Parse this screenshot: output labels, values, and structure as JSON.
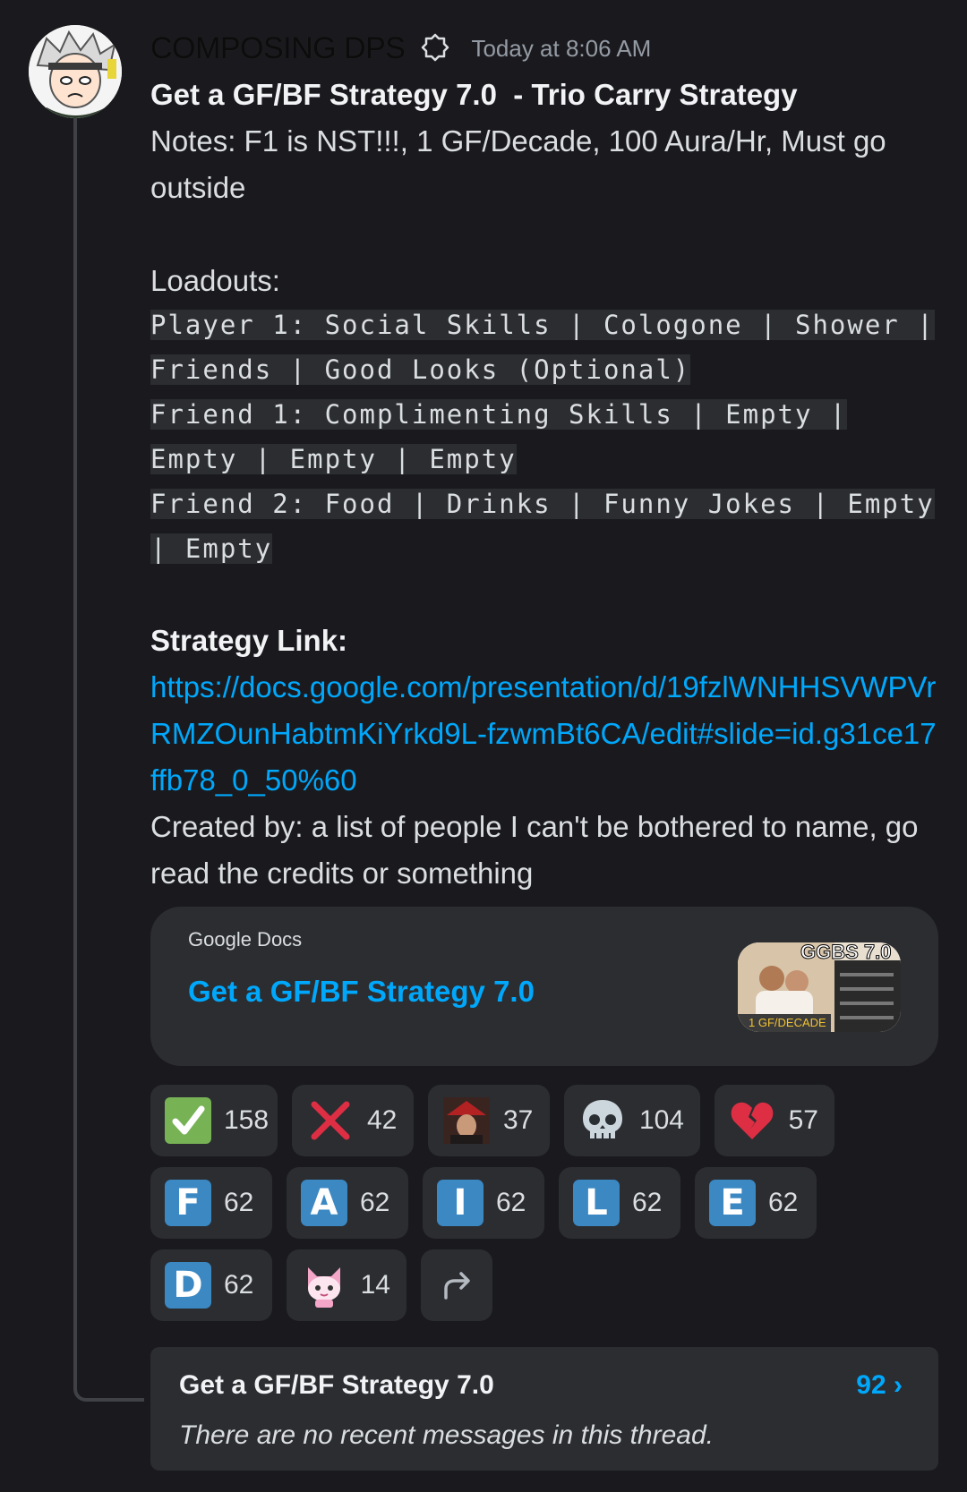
{
  "message": {
    "username": "COMPOSING DPS",
    "timestamp": "Today at 8:06 AM",
    "title": "Get a GF/BF Strategy 7.0  - Trio Carry Strategy",
    "notes": "Notes: F1 is NST!!!, 1 GF/Decade, 100 Aura/Hr, Must go outside",
    "loadouts_heading": "Loadouts:",
    "loadouts": [
      "Player 1: Social Skills | Cologone | Shower | Friends | Good Looks (Optional)",
      "Friend 1: Complimenting Skills | Empty | Empty | Empty | Empty",
      "Friend 2: Food | Drinks | Funny Jokes | Empty | Empty"
    ],
    "strategy_link_label": "Strategy Link:",
    "strategy_link": "https://docs.google.com/presentation/d/19fzlWNHHSVWPVrRMZOunHabtmKiYrkd9L-fzwmBt6CA/edit#slide=id.g31ce17ffb78_0_50%60",
    "created_by": "Created by: a list of people I can't be bothered to name, go read the credits or something"
  },
  "embed": {
    "provider": "Google Docs",
    "title": "Get a GF/BF Strategy 7.0",
    "thumbnail_text": "GGBS 7.0",
    "thumbnail_caption": "1 GF/DECADE"
  },
  "reactions": [
    [
      {
        "emoji": "check-mark-icon",
        "count": "158"
      },
      {
        "emoji": "cross-mark-icon",
        "count": "42"
      },
      {
        "emoji": "custom-character-emoji",
        "count": "37"
      },
      {
        "emoji": "skull-icon",
        "count": "104"
      },
      {
        "emoji": "broken-heart-icon",
        "count": "57"
      }
    ],
    [
      {
        "emoji": "letter-f",
        "letter": "F",
        "count": "62"
      },
      {
        "emoji": "letter-a",
        "letter": "A",
        "count": "62"
      },
      {
        "emoji": "letter-i",
        "letter": "I",
        "count": "62"
      },
      {
        "emoji": "letter-l",
        "letter": "L",
        "count": "62"
      },
      {
        "emoji": "letter-e",
        "letter": "E",
        "count": "62"
      }
    ],
    [
      {
        "emoji": "letter-d",
        "letter": "D",
        "count": "62"
      },
      {
        "emoji": "pink-cat-emoji",
        "count": "14"
      }
    ]
  ],
  "thread": {
    "title": "Get a GF/BF Strategy 7.0",
    "count": "92 ›",
    "empty_text": "There are no recent messages in this thread."
  },
  "colors": {
    "background": "#1a1a1e",
    "card": "#2b2d31",
    "link": "#00a8fc",
    "letter_tile": "#3b88c3"
  }
}
